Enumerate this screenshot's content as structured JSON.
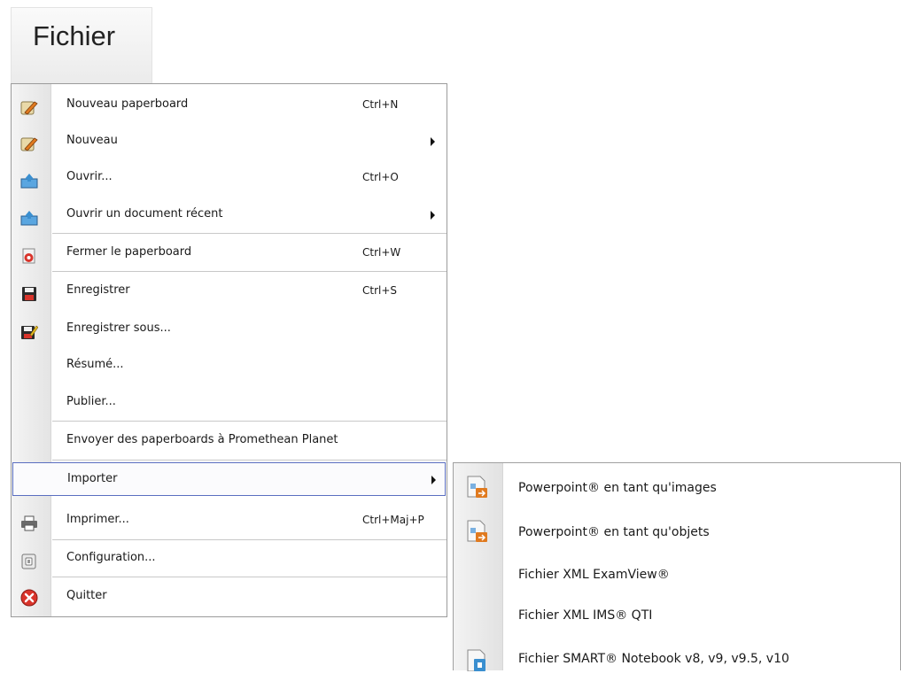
{
  "menubar": {
    "file_label": "Fichier"
  },
  "menu": {
    "items": [
      {
        "label": "Nouveau paperboard",
        "shortcut": "Ctrl+N",
        "icon": "new-flipchart-icon"
      },
      {
        "label": "Nouveau",
        "shortcut": "",
        "icon": "new-icon",
        "submenu": true
      },
      {
        "label": "Ouvrir...",
        "shortcut": "Ctrl+O",
        "icon": "open-icon"
      },
      {
        "label": "Ouvrir un document récent",
        "shortcut": "",
        "icon": "open-recent-icon",
        "submenu": true
      },
      {
        "label": "Fermer le paperboard",
        "shortcut": "Ctrl+W",
        "icon": "close-flipchart-icon"
      },
      {
        "label": "Enregistrer",
        "shortcut": "Ctrl+S",
        "icon": "save-icon"
      },
      {
        "label": "Enregistrer sous...",
        "shortcut": "",
        "icon": "save-as-icon"
      },
      {
        "label": "Résumé...",
        "shortcut": "",
        "icon": ""
      },
      {
        "label": "Publier...",
        "shortcut": "",
        "icon": ""
      },
      {
        "label": "Envoyer des paperboards à Promethean Planet",
        "shortcut": "",
        "icon": ""
      },
      {
        "label": "Importer",
        "shortcut": "",
        "icon": "",
        "submenu": true,
        "highlighted": true
      },
      {
        "label": "Imprimer...",
        "shortcut": "Ctrl+Maj+P",
        "icon": "printer-icon"
      },
      {
        "label": "Configuration...",
        "shortcut": "",
        "icon": "settings-icon"
      },
      {
        "label": "Quitter",
        "shortcut": "",
        "icon": "exit-icon"
      }
    ]
  },
  "submenu": {
    "items": [
      {
        "label": "Powerpoint® en tant qu'images",
        "icon": "powerpoint-import-icon"
      },
      {
        "label": "Powerpoint® en tant qu'objets",
        "icon": "powerpoint-import-icon"
      },
      {
        "label": "Fichier XML ExamView®",
        "icon": ""
      },
      {
        "label": "Fichier XML IMS® QTI",
        "icon": ""
      },
      {
        "label": "Fichier SMART® Notebook v8, v9, v9.5, v10",
        "icon": "smart-notebook-icon"
      }
    ]
  },
  "colors": {
    "highlight_border": "#5a6ec0",
    "accent_orange": "#e07a1f",
    "accent_blue": "#3a8fd0",
    "exit_red": "#d9342b"
  }
}
